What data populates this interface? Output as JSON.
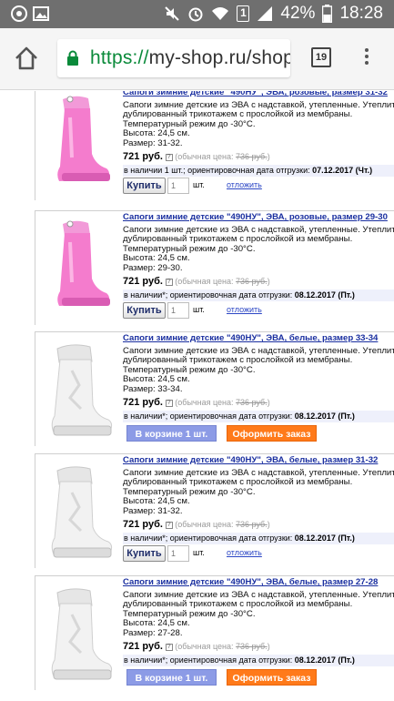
{
  "status_bar": {
    "sim_slot": "1",
    "battery": "42%",
    "time": "18:28",
    "icons": [
      "chrome-app-icon",
      "gallery-icon",
      "mute-icon",
      "alarm-icon",
      "wifi-icon",
      "sim-icon",
      "signal-icon",
      "battery-icon"
    ]
  },
  "browser": {
    "url_protocol": "https://",
    "url_rest": "my-shop.ru/shop",
    "tab_count": "19"
  },
  "colors": {
    "link": "#1a2fa0",
    "availability_bg": "#eef0fb",
    "in_cart_button": "#8c9be6",
    "order_button": "#ff7a1a",
    "pink_boot": "#f47ccd",
    "white_boot": "#f2f2f2"
  },
  "products": [
    {
      "title": "Сапоги зимние детские \"490НУ\", ЭВА, розовые, размер 31-32",
      "desc1": "Сапоги зимние детские из ЭВА с надставкой, утепленные. Утеплитель из нату",
      "desc2": "дублированный трикотажем с прослойкой из мембраны.",
      "desc3": "Температурный режим до -30°С.",
      "height": "Высота: 24,5 см.",
      "size": "Размер: 31-32.",
      "price": "721 руб.",
      "old_price_label": "(обычная цена: ",
      "old_price": "736 руб.",
      "old_price_close": ")",
      "availability": "в наличии 1 шт.; ориентировочная дата отгрузки: ",
      "ship_date": "07.12.2017 (Чт.)",
      "buy_label": "Купить",
      "qty": "1",
      "unit": "шт.",
      "postpone_label": "отложить",
      "color": "pink"
    },
    {
      "title": "Сапоги зимние детские \"490НУ\", ЭВА, розовые, размер 29-30",
      "desc1": "Сапоги зимние детские из ЭВА с надставкой, утепленные. Утеплитель из нату",
      "desc2": "дублированный трикотажем с прослойкой из мембраны.",
      "desc3": "Температурный режим до -30°С.",
      "height": "Высота: 24,5 см.",
      "size": "Размер: 29-30.",
      "price": "721 руб.",
      "old_price_label": "(обычная цена: ",
      "old_price": "736 руб.",
      "old_price_close": ")",
      "availability": "в наличии*; ориентировочная дата отгрузки: ",
      "ship_date": "08.12.2017 (Пт.)",
      "buy_label": "Купить",
      "qty": "1",
      "unit": "шт.",
      "postpone_label": "отложить",
      "color": "pink"
    },
    {
      "title": "Сапоги зимние детские \"490НУ\", ЭВА, белые, размер 33-34",
      "desc1": "Сапоги зимние детские из ЭВА с надставкой, утепленные. Утеплитель из нату",
      "desc2": "дублированный трикотажем с прослойкой из мембраны.",
      "desc3": "Температурный режим до -30°С.",
      "height": "Высота: 24,5 см.",
      "size": "Размер: 33-34.",
      "price": "721 руб.",
      "old_price_label": "(обычная цена: ",
      "old_price": "736 руб.",
      "old_price_close": ")",
      "availability": "в наличии*; ориентировочная дата отгрузки: ",
      "ship_date": "08.12.2017 (Пт.)",
      "in_cart_label": "В корзине 1 шт.",
      "order_label": "Оформить заказ",
      "color": "white"
    },
    {
      "title": "Сапоги зимние детские \"490НУ\", ЭВА, белые, размер 31-32",
      "desc1": "Сапоги зимние детские из ЭВА с надставкой, утепленные. Утеплитель из нату",
      "desc2": "дублированный трикотажем с прослойкой из мембраны.",
      "desc3": "Температурный режим до -30°С.",
      "height": "Высота: 24,5 см.",
      "size": "Размер: 31-32.",
      "price": "721 руб.",
      "old_price_label": "(обычная цена: ",
      "old_price": "736 руб.",
      "old_price_close": ")",
      "availability": "в наличии*; ориентировочная дата отгрузки: ",
      "ship_date": "08.12.2017 (Пт.)",
      "buy_label": "Купить",
      "qty": "1",
      "unit": "шт.",
      "postpone_label": "отложить",
      "color": "white"
    },
    {
      "title": "Сапоги зимние детские \"490НУ\", ЭВА, белые, размер 27-28",
      "desc1": "Сапоги зимние детские из ЭВА с надставкой, утепленные. Утеплитель из нату",
      "desc2": "дублированный трикотажем с прослойкой из мембраны.",
      "desc3": "Температурный режим до -30°С.",
      "height": "Высота: 24,5 см.",
      "size": "Размер: 27-28.",
      "price": "721 руб.",
      "old_price_label": "(обычная цена: ",
      "old_price": "736 руб.",
      "old_price_close": ")",
      "availability": "в наличии*; ориентировочная дата отгрузки: ",
      "ship_date": "08.12.2017 (Пт.)",
      "in_cart_label": "В корзине 1 шт.",
      "order_label": "Оформить заказ",
      "color": "white"
    }
  ]
}
